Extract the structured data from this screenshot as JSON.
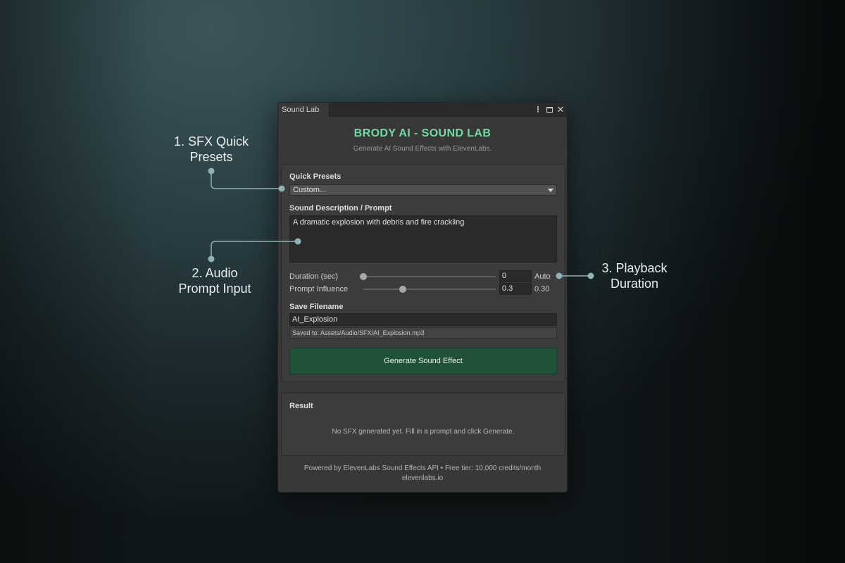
{
  "window": {
    "tab_label": "Sound Lab",
    "menu_glyph": "⋮",
    "close_glyph": "✕",
    "title": "BRODY AI - SOUND LAB",
    "subtitle": "Generate AI Sound Effects with ElevenLabs."
  },
  "presets": {
    "label": "Quick Presets",
    "selected": "Custom..."
  },
  "prompt": {
    "label": "Sound Description / Prompt",
    "value": "A dramatic explosion with debris and fire crackling"
  },
  "duration": {
    "label": "Duration (sec)",
    "value": "0",
    "display": "Auto",
    "slider_fraction": 0.0
  },
  "influence": {
    "label": "Prompt Influence",
    "value": "0.3",
    "display": "0.30",
    "slider_fraction": 0.3
  },
  "save": {
    "label": "Save Filename",
    "value": "AI_Explosion",
    "saved_path": "Saved to: Assets/Audio/SFX/AI_Explosion.mp3"
  },
  "generate_label": "Generate Sound Effect",
  "result": {
    "label": "Result",
    "empty_text": "No SFX generated yet. Fill in a prompt and click Generate."
  },
  "footer": {
    "line1": "Powered by ElevenLabs Sound Effects API  •  Free tier: 10,000 credits/month",
    "line2": "elevenlabs.io"
  },
  "callouts": {
    "presets": [
      "1. SFX Quick",
      "Presets"
    ],
    "prompt": [
      "2. Audio",
      "Prompt Input"
    ],
    "duration": [
      "3. Playback",
      "Duration"
    ]
  },
  "colors": {
    "accent": "#6fdca0",
    "generate_button": "#1f5237",
    "callout_line": "#8fb3b5"
  }
}
